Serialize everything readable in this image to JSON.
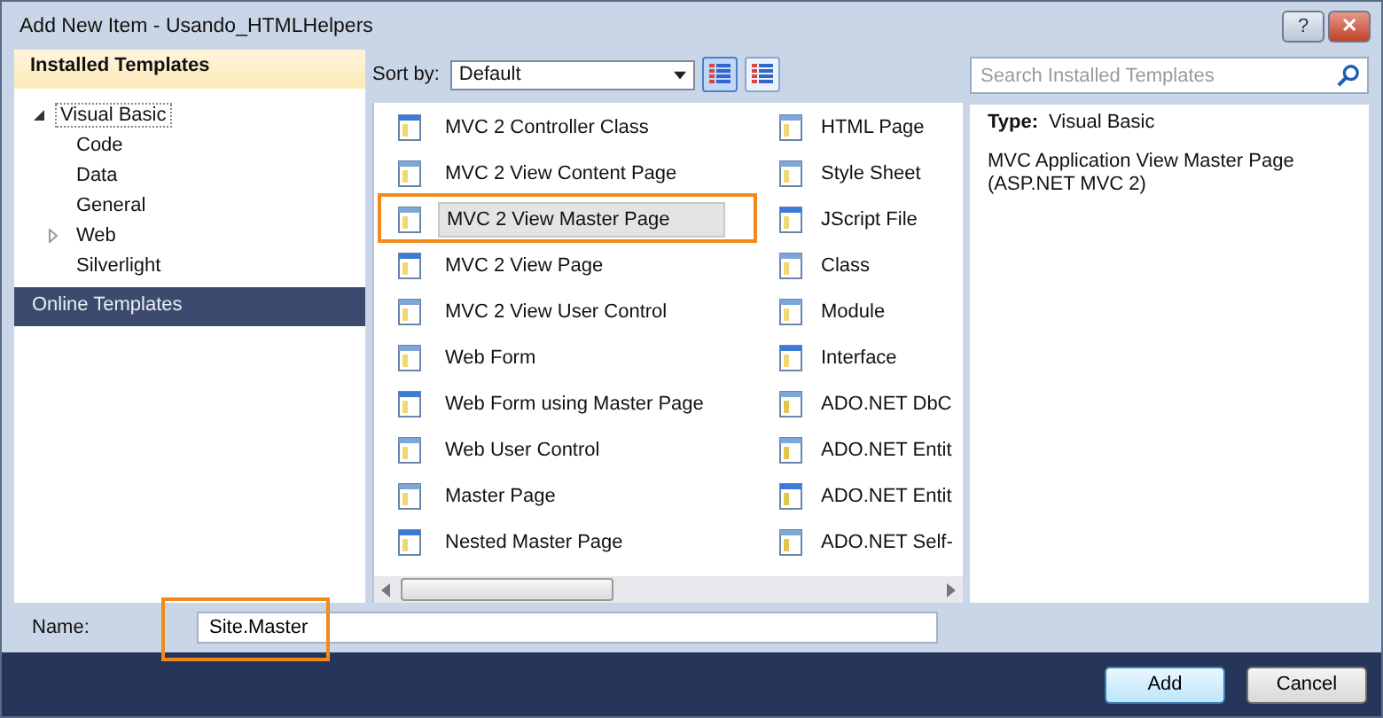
{
  "window": {
    "title": "Add New Item - Usando_HTMLHelpers",
    "help_button": "?",
    "close_button": "✕"
  },
  "sidebar": {
    "header": "Installed Templates",
    "tree": [
      {
        "label": "Visual Basic",
        "expanded": true,
        "selected": true,
        "children": [
          {
            "label": "Code",
            "selected": false
          },
          {
            "label": "Data",
            "selected": false
          },
          {
            "label": "General",
            "selected": false
          },
          {
            "label": "Web",
            "selected": false,
            "expanded": false
          },
          {
            "label": "Silverlight",
            "selected": false
          }
        ]
      }
    ],
    "online": {
      "label": "Online Templates",
      "selected": true
    }
  },
  "toolbar": {
    "sort_label": "Sort by:",
    "sort_value": "Default",
    "views": [
      {
        "selected": true
      },
      {
        "selected": false
      }
    ]
  },
  "search": {
    "placeholder": "Search Installed Templates"
  },
  "templates": [
    {
      "label": "MVC 2 Controller Class",
      "selected": false,
      "annotated": false
    },
    {
      "label": "MVC 2 View Content Page",
      "selected": false,
      "annotated": false
    },
    {
      "label": "MVC 2 View Master Page",
      "selected": true,
      "annotated": true
    },
    {
      "label": "MVC 2 View Page",
      "selected": false,
      "annotated": false
    },
    {
      "label": "MVC 2 View User Control",
      "selected": false,
      "annotated": false
    },
    {
      "label": "Web Form",
      "selected": false,
      "annotated": false
    },
    {
      "label": "Web Form using Master Page",
      "selected": false,
      "annotated": false
    },
    {
      "label": "Web User Control",
      "selected": false,
      "annotated": false
    },
    {
      "label": "Master Page",
      "selected": false,
      "annotated": false
    },
    {
      "label": "Nested Master Page",
      "selected": false,
      "annotated": false
    },
    {
      "label": "HTML Page",
      "selected": false,
      "annotated": false
    },
    {
      "label": "Style Sheet",
      "selected": false,
      "annotated": false
    },
    {
      "label": "JScript File",
      "selected": false,
      "annotated": false
    },
    {
      "label": "Class",
      "selected": false,
      "annotated": false
    },
    {
      "label": "Module",
      "selected": false,
      "annotated": false
    },
    {
      "label": "Interface",
      "selected": false,
      "annotated": false
    },
    {
      "label": "ADO.NET DbC",
      "selected": false,
      "annotated": false
    },
    {
      "label": "ADO.NET Entit",
      "selected": false,
      "annotated": false
    },
    {
      "label": "ADO.NET Entit",
      "selected": false,
      "annotated": false
    },
    {
      "label": "ADO.NET Self-",
      "selected": false,
      "annotated": false
    }
  ],
  "details": {
    "type_label": "Type:",
    "type_value": "Visual Basic",
    "description": "MVC Application View Master Page (ASP.NET MVC 2)"
  },
  "name_field": {
    "label": "Name:",
    "value": "Site.Master",
    "annotated": true
  },
  "buttons": [
    {
      "label": "Add",
      "default": true
    },
    {
      "label": "Cancel",
      "default": false
    }
  ]
}
